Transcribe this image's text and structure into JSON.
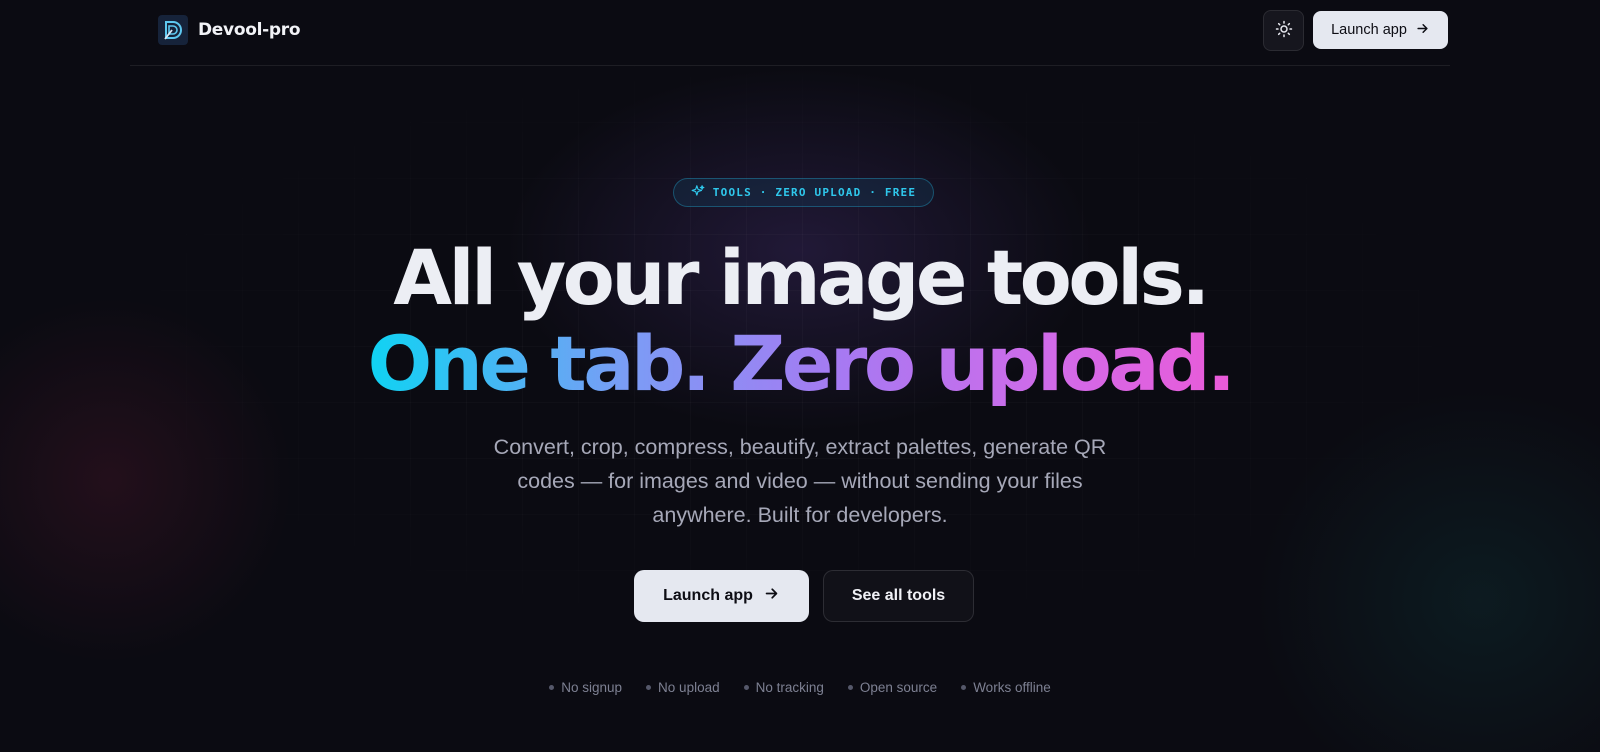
{
  "header": {
    "brand_name": "Devool-pro",
    "launch_label": "Launch app"
  },
  "hero": {
    "badge_text": "TOOLS · ZERO UPLOAD · FREE",
    "headline_line1": "All your image tools.",
    "headline_line2": "One tab. Zero upload.",
    "subtitle": "Convert, crop, compress, beautify, extract palettes, generate QR codes — for images and video — without sending your files anywhere. Built for developers.",
    "primary_cta": "Launch app",
    "secondary_cta": "See all tools"
  },
  "features": [
    "No signup",
    "No upload",
    "No tracking",
    "Open source",
    "Works offline"
  ],
  "icons": {
    "logo": "devool-logo-icon",
    "theme": "sun-icon",
    "arrow": "arrow-right-icon",
    "badge": "sparkles-icon"
  },
  "colors": {
    "background": "#0b0b12",
    "accent_cyan": "#0fd3f3",
    "accent_pink": "#ea5ad8",
    "button_light": "#e5e8f0"
  }
}
